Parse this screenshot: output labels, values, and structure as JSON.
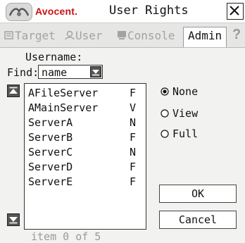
{
  "titlebar": {
    "logo_text": "Avocent.",
    "title": "User Rights"
  },
  "tabs": [
    {
      "label": "Target",
      "icon": "target-icon",
      "active": false
    },
    {
      "label": "User",
      "icon": "user-icon",
      "active": false
    },
    {
      "label": "Console",
      "icon": "console-icon",
      "active": false
    },
    {
      "label": "Admin",
      "active": true
    }
  ],
  "help_icon": "?",
  "form": {
    "username_label": "Username:",
    "find_label": "Find:",
    "find_value": "name"
  },
  "servers": [
    {
      "name": "AFileServer",
      "right": "F"
    },
    {
      "name": "AMainServer",
      "right": "V"
    },
    {
      "name": "ServerA",
      "right": "N"
    },
    {
      "name": "ServerB",
      "right": "F"
    },
    {
      "name": "ServerC",
      "right": "N"
    },
    {
      "name": "ServerD",
      "right": "F"
    },
    {
      "name": "ServerE",
      "right": "F"
    }
  ],
  "status": "item 0 of 5",
  "rights": [
    {
      "label": "None",
      "selected": true
    },
    {
      "label": "View",
      "selected": false
    },
    {
      "label": "Full",
      "selected": false
    }
  ],
  "buttons": {
    "ok": "OK",
    "cancel": "Cancel"
  },
  "colors": {
    "brand": "#cc1111",
    "disabled_text": "#a3a3a3"
  }
}
